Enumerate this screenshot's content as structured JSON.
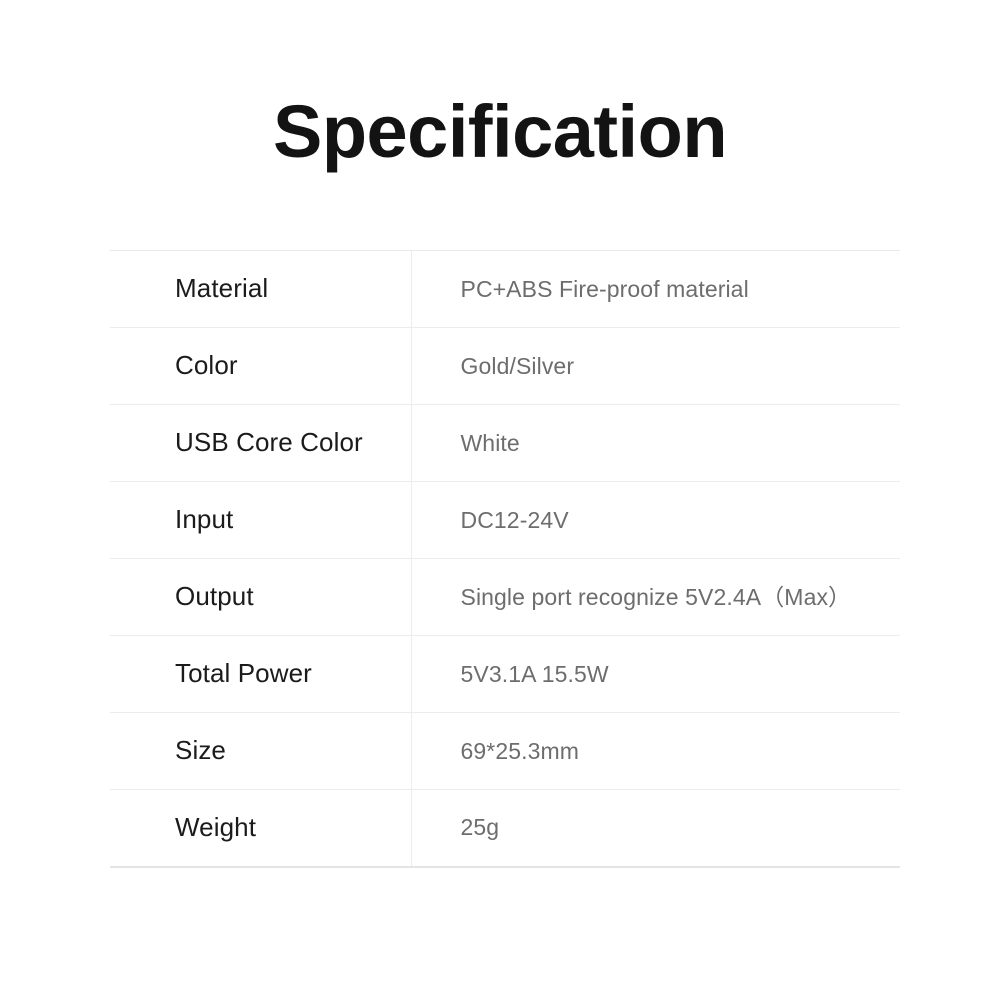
{
  "page": {
    "title": "Specification",
    "background_color": "#ffffff",
    "label_color": "#1b1b1b",
    "value_color": "#6d6d6d",
    "border_color": "#ececec"
  },
  "spec_table": {
    "rows": [
      {
        "label": "Material",
        "value": "PC+ABS Fire-proof material"
      },
      {
        "label": "Color",
        "value": "Gold/Silver"
      },
      {
        "label": "USB Core Color",
        "value": "White"
      },
      {
        "label": "Input",
        "value": "DC12-24V"
      },
      {
        "label": "Output",
        "value": "Single port recognize 5V2.4A（Max）"
      },
      {
        "label": "Total Power",
        "value": "5V3.1A 15.5W"
      },
      {
        "label": "Size",
        "value": "69*25.3mm"
      },
      {
        "label": "Weight",
        "value": "25g"
      }
    ]
  }
}
